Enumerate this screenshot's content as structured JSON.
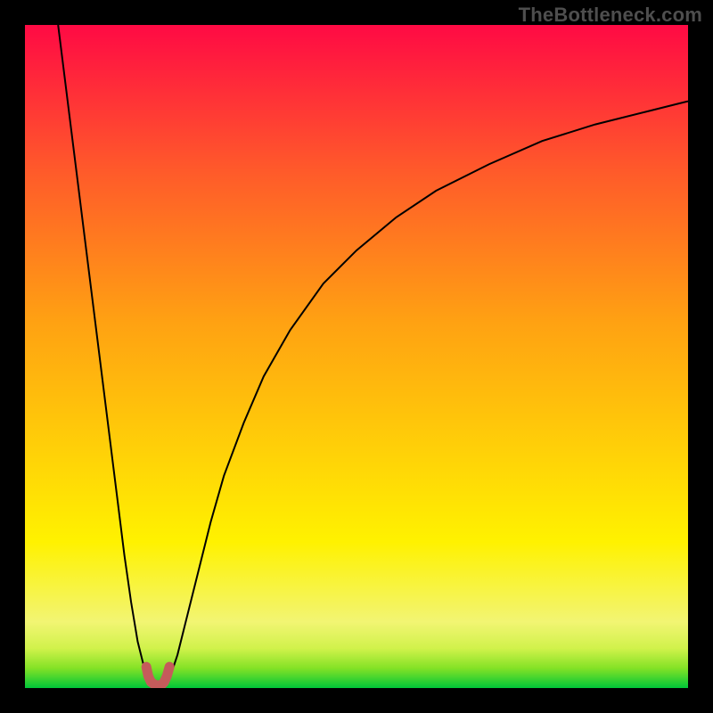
{
  "watermark": "TheBottleneck.com",
  "chart_data": {
    "type": "line",
    "title": "",
    "xlabel": "",
    "ylabel": "",
    "xlim": [
      0,
      100
    ],
    "ylim": [
      0,
      100
    ],
    "grid": false,
    "legend": false,
    "background": {
      "kind": "vertical-gradient",
      "stops": [
        {
          "pos": 0,
          "color": "#00c638"
        },
        {
          "pos": 3,
          "color": "#84e226"
        },
        {
          "pos": 6,
          "color": "#d1f24b"
        },
        {
          "pos": 10,
          "color": "#f2f573"
        },
        {
          "pos": 22,
          "color": "#fff200"
        },
        {
          "pos": 55,
          "color": "#ffa212"
        },
        {
          "pos": 78,
          "color": "#ff5a2a"
        },
        {
          "pos": 100,
          "color": "#ff0a44"
        }
      ]
    },
    "series": [
      {
        "name": "left-branch",
        "color": "#000000",
        "stroke_width": 2,
        "x": [
          5,
          6,
          7,
          8,
          9,
          10,
          11,
          12,
          13,
          14,
          15,
          16,
          17,
          18,
          18.5,
          19
        ],
        "y": [
          100,
          92,
          84,
          76,
          68,
          60,
          52,
          44,
          36,
          28,
          20,
          13,
          7,
          3,
          1.2,
          0.5
        ]
      },
      {
        "name": "right-branch",
        "color": "#000000",
        "stroke_width": 2,
        "x": [
          21,
          22,
          23,
          24,
          26,
          28,
          30,
          33,
          36,
          40,
          45,
          50,
          56,
          62,
          70,
          78,
          86,
          94,
          100
        ],
        "y": [
          0.5,
          2,
          5,
          9,
          17,
          25,
          32,
          40,
          47,
          54,
          61,
          66,
          71,
          75,
          79,
          82.5,
          85,
          87,
          88.5
        ]
      },
      {
        "name": "highlight-nub",
        "color": "#c55b5b",
        "stroke_width": 11,
        "linecap": "round",
        "x": [
          18.3,
          18.6,
          19.0,
          19.6,
          20.0,
          20.6,
          21.0,
          21.4,
          21.8
        ],
        "y": [
          3.2,
          1.8,
          0.9,
          0.5,
          0.4,
          0.5,
          0.9,
          1.8,
          3.2
        ]
      }
    ]
  }
}
